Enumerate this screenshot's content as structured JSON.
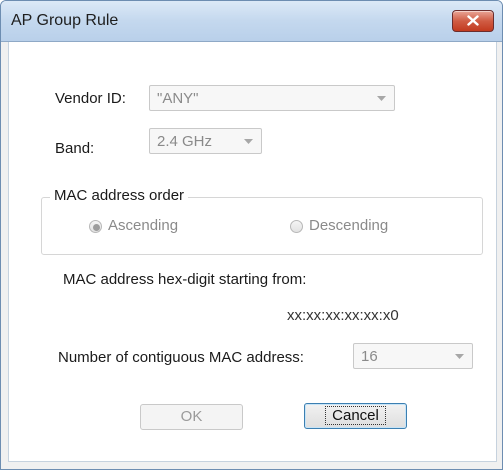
{
  "window": {
    "title": "AP Group Rule"
  },
  "form": {
    "vendor_label": "Vendor ID:",
    "vendor_value": "\"ANY\"",
    "band_label": "Band:",
    "band_value": "2.4 GHz",
    "mac_order_group_label": "MAC address order",
    "ascending_label": "Ascending",
    "descending_label": "Descending",
    "mac_order_selected": "Ascending",
    "hex_start_label": "MAC address hex-digit starting from:",
    "hex_start_value": "xx:xx:xx:xx:xx:x0",
    "contiguous_label": "Number of contiguous MAC address:",
    "contiguous_value": "16"
  },
  "buttons": {
    "ok_label": "OK",
    "cancel_label": "Cancel"
  },
  "icons": {
    "close": "close-icon",
    "dropdown": "chevron-down-icon"
  },
  "colors": {
    "close_button": "#c23a1f",
    "title_bar": "#c4d8ee"
  }
}
